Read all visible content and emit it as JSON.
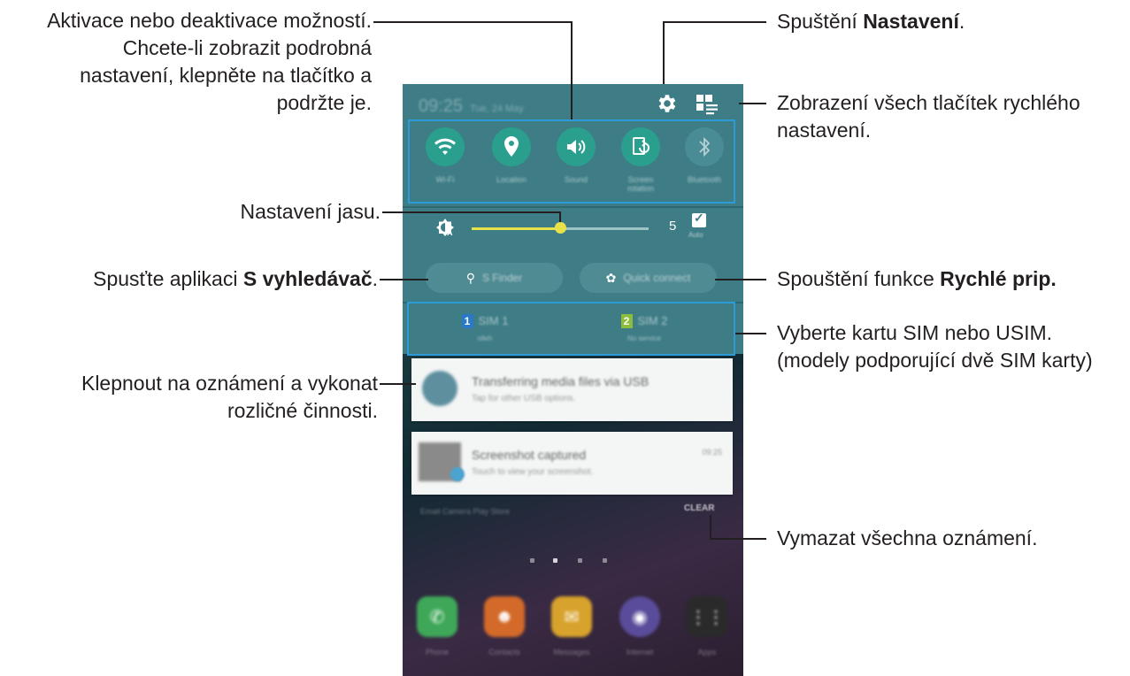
{
  "callouts": {
    "toggle": {
      "line1": "Aktivace nebo deaktivace možností.",
      "line2": "Chcete-li zobrazit podrobná",
      "line3": "nastavení, klepněte na tlačítko a",
      "line4": "podržte je."
    },
    "brightness": {
      "text": "Nastavení jasu."
    },
    "sfinder": {
      "prefix": "Spusťte aplikaci ",
      "bold": "S vyhledávač",
      "suffix": "."
    },
    "notification": {
      "line1": "Klepnout na oznámení a vykonat",
      "line2": "rozličné činnosti."
    },
    "settings": {
      "prefix": "Spuštění ",
      "bold": "Nastavení",
      "suffix": "."
    },
    "all_buttons": {
      "line1": "Zobrazení všech tlačítek rychlého",
      "line2": "nastavení."
    },
    "quick_connect": {
      "prefix": "Spouštění funkce ",
      "bold": "Rychlé prip."
    },
    "sim": {
      "line1": "Vyberte kartu SIM nebo USIM.",
      "line2": "(modely podporující dvě SIM karty)"
    },
    "clear": {
      "text": "Vymazat všechna oznámení."
    }
  },
  "phone": {
    "status": {
      "time": "09:25",
      "date": "Tue, 24 May"
    },
    "quick_settings": [
      {
        "label": "Wi-Fi",
        "icon": "wifi-icon",
        "active": true
      },
      {
        "label": "Location",
        "icon": "location-pin-icon",
        "active": true
      },
      {
        "label": "Sound",
        "icon": "sound-icon",
        "active": true
      },
      {
        "label": "Screen rotation",
        "icon": "screen-rotation-icon",
        "active": true
      },
      {
        "label": "Bluetooth",
        "icon": "bluetooth-icon",
        "active": false
      }
    ],
    "brightness": {
      "value": "5",
      "auto_label": "Auto",
      "level": 0.5
    },
    "search_buttons": {
      "sfinder": "S Finder",
      "quick_connect": "Quick connect"
    },
    "sims": [
      {
        "num": "1",
        "name": "SIM 1",
        "sub": "olleh",
        "color": "#2a78c8"
      },
      {
        "num": "2",
        "name": "SIM 2",
        "sub": "No service",
        "color": "#8dbd3c"
      }
    ],
    "notifications": [
      {
        "title": "Transferring media files via USB",
        "sub": "Tap for other USB options.",
        "time": ""
      },
      {
        "title": "Screenshot captured",
        "sub": "Touch to view your screenshot.",
        "time": "09:25"
      }
    ],
    "clear_label": "CLEAR",
    "home_labels": "Email      Camera      Play Store",
    "dock": [
      {
        "label": "Phone",
        "icon": "phone-icon",
        "color": "#3fa858"
      },
      {
        "label": "Contacts",
        "icon": "contacts-icon",
        "color": "#d46a2a"
      },
      {
        "label": "Messages",
        "icon": "messages-icon",
        "color": "#d8a32c"
      },
      {
        "label": "Internet",
        "icon": "internet-icon",
        "color": "#5a4c9a"
      },
      {
        "label": "Apps",
        "icon": "apps-icon",
        "color": "#2a2a2a"
      }
    ]
  },
  "colors": {
    "highlight": "#2c9bd7",
    "panel": "#3e7d86",
    "toggle_on": "#2a9f8e"
  }
}
